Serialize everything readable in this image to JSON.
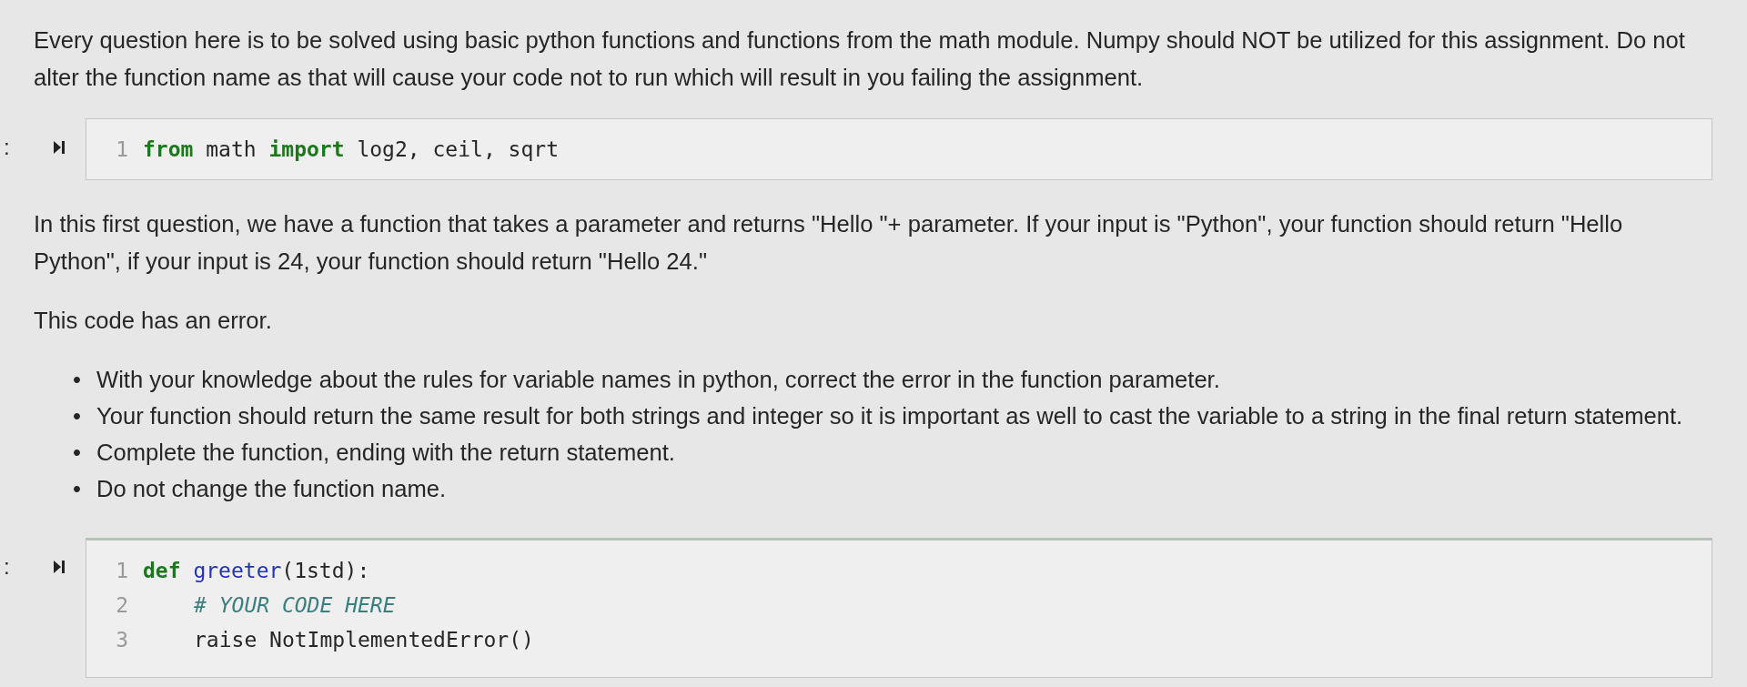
{
  "blocks": [
    {
      "kind": "paragraph",
      "text": "Every question here is to be solved using basic python functions and functions from the math module. Numpy should NOT be utilized for this assignment. Do not alter the function name as that will cause your code not to run which will result in you failing the assignment."
    },
    {
      "kind": "code",
      "prompt": ":",
      "lines": [
        {
          "number": "1",
          "tokens": [
            {
              "kind": "keyword",
              "text": "from"
            },
            {
              "kind": "plain",
              "text": " math "
            },
            {
              "kind": "keyword",
              "text": "import"
            },
            {
              "kind": "plain",
              "text": " log2, ceil, sqrt"
            }
          ]
        }
      ]
    },
    {
      "kind": "paragraph",
      "text": "In this first question, we have a function that takes a parameter and returns \"Hello \"+ parameter. If your input is \"Python\", your function should return \"Hello Python\", if your input is 24, your function should return \"Hello 24.\""
    },
    {
      "kind": "paragraph",
      "text": "This code has an error."
    },
    {
      "kind": "bullets",
      "items": [
        {
          "marker": "•",
          "text": "With your knowledge about the rules for variable names in python, correct the error in the function parameter."
        },
        {
          "marker": "•",
          "text": "Your function should return the same result for both strings and integer so it is important as well to cast the variable to a string in the final return statement."
        },
        {
          "marker": "•",
          "text": "Complete the function, ending with the return statement."
        },
        {
          "marker": "•",
          "text": "Do not change the function name."
        }
      ]
    },
    {
      "kind": "code",
      "prompt": ":",
      "lines": [
        {
          "number": "1",
          "tokens": [
            {
              "kind": "keyword",
              "text": "def"
            },
            {
              "kind": "name",
              "text": " greeter"
            },
            {
              "kind": "plain",
              "text": "(1std):"
            }
          ]
        },
        {
          "number": "2",
          "indent": true,
          "tokens": [
            {
              "kind": "comment",
              "text": "# YOUR CODE HERE"
            }
          ]
        },
        {
          "number": "3",
          "indent": true,
          "tokens": [
            {
              "kind": "plain",
              "text": "raise NotImplementedError()"
            }
          ]
        }
      ]
    }
  ]
}
